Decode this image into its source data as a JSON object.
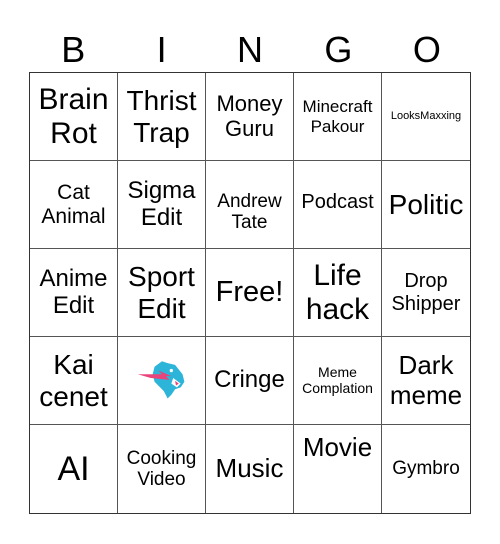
{
  "title_letters": [
    "B",
    "I",
    "N",
    "G",
    "O"
  ],
  "cells": [
    {
      "text": "Brain Rot"
    },
    {
      "text": "Thrist Trap"
    },
    {
      "text": "Money Guru"
    },
    {
      "text": "Minecraft Pakour"
    },
    {
      "text": "LooksMaxxing"
    },
    {
      "text": "Cat Animal"
    },
    {
      "text": "Sigma Edit"
    },
    {
      "text": "Andrew Tate"
    },
    {
      "text": "Podcast"
    },
    {
      "text": "Politic"
    },
    {
      "text": "Anime Edit"
    },
    {
      "text": "Sport Edit"
    },
    {
      "text": "Free!"
    },
    {
      "text": "Life hack"
    },
    {
      "text": "Drop Shipper"
    },
    {
      "text": "Kai cenet"
    },
    {
      "text": "",
      "icon": "mrbeast-panther-logo"
    },
    {
      "text": "Cringe"
    },
    {
      "text": "Meme Complation"
    },
    {
      "text": "Dark meme"
    },
    {
      "text": "AI"
    },
    {
      "text": "Cooking Video"
    },
    {
      "text": "Music"
    },
    {
      "text": "Movie"
    },
    {
      "text": "Gymbro"
    }
  ],
  "colors": {
    "logo_primary": "#2cb5d8",
    "logo_accent": "#e8437a"
  }
}
